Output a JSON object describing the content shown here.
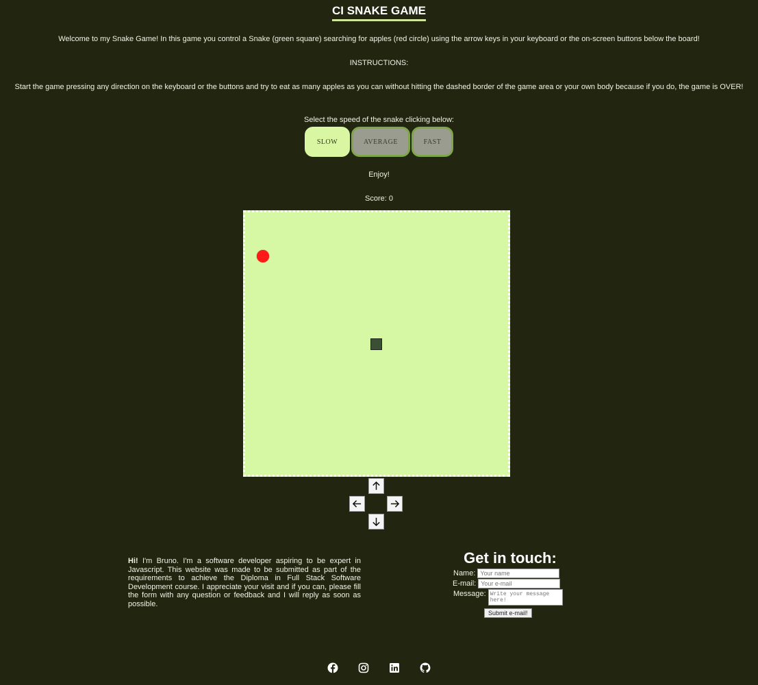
{
  "header": {
    "title": "CI SNAKE GAME"
  },
  "intro": {
    "welcome": "Welcome to my Snake Game! In this game you control a Snake (green square) searching for apples (red circle) using the arrow keys in your keyboard or the on-screen buttons below the board!",
    "instructions_heading": "INSTRUCTIONS:",
    "instructions": "Start the game pressing any direction on the keyboard or the buttons and try to eat as many apples as you can without hitting the dashed border of the game area or your own body because if you do, the game is OVER!",
    "select_speed": "Select the speed of the snake clicking below:"
  },
  "speed": {
    "options": [
      "SLOW",
      "AVERAGE",
      "FAST"
    ],
    "selected": "SLOW"
  },
  "enjoy": "Enjoy!",
  "score": {
    "text": "Score: 0"
  },
  "game": {
    "board_color": "#d6f7a3",
    "apple_color": "#ff1a1a",
    "snake_color": "#3b4f35"
  },
  "controls": {
    "up_icon": "arrow-up-icon",
    "left_icon": "arrow-left-icon",
    "right_icon": "arrow-right-icon",
    "down_icon": "arrow-down-icon"
  },
  "about": {
    "greeting": "Hi!",
    "text": " I'm Bruno. I'm a software developer aspiring to be expert in Javascript. This website was made to be submitted as part of the requirements to achieve the Diploma in Full Stack Software Development course. I appreciate your visit and if you can, please fill the form with any question or feedback and I will reply as soon as possible."
  },
  "contact": {
    "heading": "Get in touch:",
    "name_label": "Name:",
    "name_placeholder": "Your name",
    "email_label": "E-mail:",
    "email_placeholder": "Your e-mail",
    "message_label": "Message:",
    "message_placeholder": "Write your message here!",
    "submit_label": "Submit e-mail!"
  },
  "social": [
    "facebook-icon",
    "instagram-icon",
    "linkedin-icon",
    "github-icon"
  ],
  "colors": {
    "background": "#222610",
    "accent": "#d9f7a3",
    "button_idle": "#9a9c8f"
  }
}
